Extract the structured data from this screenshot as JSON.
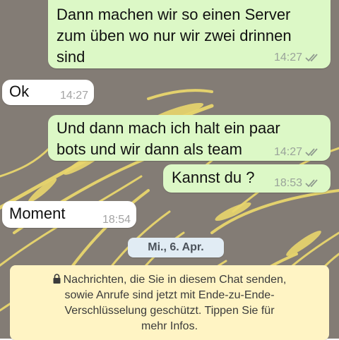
{
  "colors": {
    "background": "#837c75",
    "outgoing_bubble": "#dcf8c6",
    "incoming_bubble": "#ffffff",
    "read_ticks": "#8f9a8f",
    "date_pill": "#e1ecf4",
    "notice": "#fff4c4",
    "grass": "#e9d66d"
  },
  "messages": [
    {
      "direction": "outgoing",
      "text": "Dann machen wir so einen Server\nzum üben wo nur wir zwei drinnen\nsind",
      "time": "14:27",
      "status_icon": "double-check-icon"
    },
    {
      "direction": "incoming",
      "text": "Ok",
      "time": "14:27"
    },
    {
      "direction": "outgoing",
      "text": "Und dann mach ich halt ein paar\nbots und wir dann als team",
      "time": "14:27",
      "status_icon": "double-check-icon"
    },
    {
      "direction": "outgoing",
      "text": "Kannst du ?",
      "time": "18:53",
      "status_icon": "double-check-icon"
    },
    {
      "direction": "incoming",
      "text": "Moment",
      "time": "18:54"
    }
  ],
  "date_separator": "Mi., 6. Apr.",
  "encryption_notice": {
    "icon": "lock-icon",
    "text": "Nachrichten, die Sie in diesem Chat senden,\nsowie Anrufe sind jetzt mit Ende-zu-Ende-\nVerschlüsselung geschützt. Tippen Sie für\nmehr Infos."
  }
}
